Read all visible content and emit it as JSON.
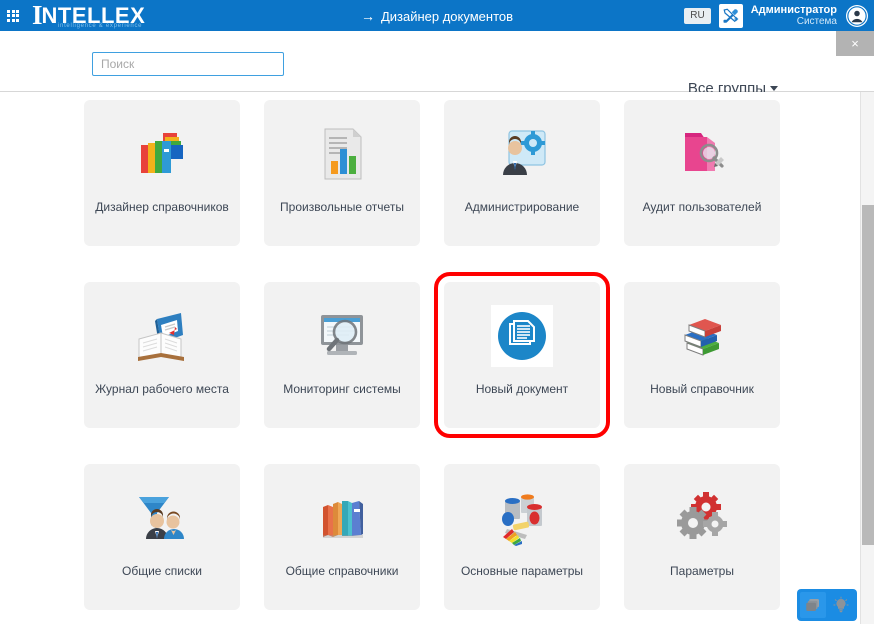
{
  "header": {
    "grid_menu_icon": "apps-grid-icon",
    "logo_initial": "I",
    "logo_text": "NTELLEX",
    "logo_tagline": "intelligence & experience",
    "page_title": "Дизайнер документов",
    "title_arrow": "→",
    "language": "RU",
    "tools_icon": "tools-icon",
    "user_name": "Администратор",
    "user_role": "Система",
    "avatar_icon": "user-avatar-icon"
  },
  "toolbar": {
    "search_placeholder": "Поиск",
    "search_value": "",
    "group_filter_label": "Все группы",
    "close_label": "×"
  },
  "tiles": [
    {
      "label": "Дизайнер справочников",
      "icon": "colored-books-icon",
      "highlighted": false
    },
    {
      "label": "Произвольные отчеты",
      "icon": "report-chart-document-icon",
      "highlighted": false
    },
    {
      "label": "Администрирование",
      "icon": "user-gear-icon",
      "highlighted": false
    },
    {
      "label": "Аудит пользователей",
      "icon": "folder-magnifier-pencil-icon",
      "highlighted": false
    },
    {
      "label": "Журнал рабочего места",
      "icon": "open-book-icon",
      "highlighted": false
    },
    {
      "label": "Мониторинг системы",
      "icon": "monitor-magnifier-icon",
      "highlighted": false
    },
    {
      "label": "Новый документ",
      "icon": "new-document-icon",
      "highlighted": true
    },
    {
      "label": "Новый справочник",
      "icon": "stacked-books-icon",
      "highlighted": false
    },
    {
      "label": "Общие списки",
      "icon": "funnel-people-icon",
      "highlighted": false
    },
    {
      "label": "Общие справочники",
      "icon": "books-row-icon",
      "highlighted": false
    },
    {
      "label": "Основные параметры",
      "icon": "paint-cans-palette-icon",
      "highlighted": false
    },
    {
      "label": "Параметры",
      "icon": "gears-icon",
      "highlighted": false
    }
  ],
  "float_buttons": [
    {
      "icon": "windows-stack-icon"
    },
    {
      "icon": "lightbulb-hint-icon"
    }
  ],
  "colors": {
    "header_blue": "#0c75c7",
    "tile_bg": "#f2f2f2",
    "highlight_red": "#ff0000",
    "accent_blue": "#1b8ce3",
    "text_dark": "#3d4755"
  }
}
